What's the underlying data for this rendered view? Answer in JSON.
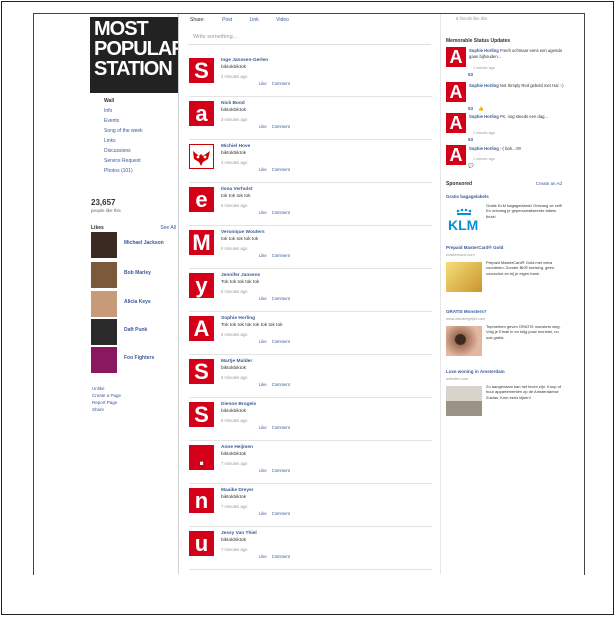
{
  "page": {
    "logo_lines": [
      "MOST",
      "POPULAR",
      "STATION"
    ]
  },
  "left_nav": {
    "items": [
      "Wall",
      "Info",
      "Events",
      "Song of the week",
      "Links",
      "Discussions",
      "Service Request",
      "Photos (101)"
    ],
    "fans_count": "23,657",
    "fans_label": "people like this",
    "likes_title": "Likes",
    "see_all": "See All",
    "likes": [
      {
        "name": "Michael Jackson",
        "color": "#3a2a22"
      },
      {
        "name": "Bob Marley",
        "color": "#7a5a3a"
      },
      {
        "name": "Alicia Keys",
        "color": "#c79b7a"
      },
      {
        "name": "Daft Punk",
        "color": "#2b2b2b"
      },
      {
        "name": "Foo Fighters",
        "color": "#8a1860"
      }
    ],
    "bottom_links": [
      "Unlike",
      "Create a Page",
      "Report Page",
      "Share"
    ]
  },
  "composer": {
    "tabs": [
      "Share:",
      "Post",
      "Link",
      "Video"
    ],
    "placeholder": "Write something..."
  },
  "feed": {
    "like_label": "Like",
    "comment_label": "Comment",
    "posts": [
      {
        "letter": "S",
        "name": "Inge Janssen-Gerlen",
        "message": "biktokbiktok",
        "time": "2 minutes ago"
      },
      {
        "letter": "a",
        "name": "Nick Bood",
        "message": "biktokbiktok",
        "time": "3 minutes ago"
      },
      {
        "letter": "",
        "name": "Michiel Hove",
        "message": "biktokbiktok",
        "time": "3 minutes ago"
      },
      {
        "letter": "e",
        "name": "Ilona Verhulst",
        "message": "tok tok tok tok",
        "time": "5 minutes ago"
      },
      {
        "letter": "M",
        "name": "Veronique Wouters",
        "message": "tok tok tok tok tok",
        "time": "6 minutes ago"
      },
      {
        "letter": "y",
        "name": "Jennifer Jansens",
        "message": "Tok tok tok tok tok",
        "time": "6 minutes ago"
      },
      {
        "letter": "A",
        "name": "Sophie Horling",
        "message": "Tok tok tok tok tok tok tok tok",
        "time": "6 minutes ago"
      },
      {
        "letter": "S",
        "name": "Martje Mulder",
        "message": "biktokbiktok",
        "time": "6 minutes ago"
      },
      {
        "letter": "S",
        "name": "Dienne Brugels",
        "message": "biktokbiktok",
        "time": "6 minutes ago"
      },
      {
        "letter": ".",
        "name": "Anne Heijmen",
        "message": "biktokbiktok",
        "time": "7 minutes ago"
      },
      {
        "letter": "n",
        "name": "Maaike Dreyer",
        "message": "biktokbiktok",
        "time": "7 minutes ago"
      },
      {
        "letter": "u",
        "name": "Jessy Van Thiel",
        "message": "biktokbiktok",
        "time": "7 minutes ago"
      }
    ]
  },
  "right": {
    "friends_text": "8 friends like this",
    "statuses_title": "Memorable Status Updates",
    "statuses": [
      {
        "name": "Sophie Horling",
        "text": "Freeh uchmaar eens een agenda gaan bijhouden...",
        "time": "1 minute ago",
        "count": "53"
      },
      {
        "name": "Sophie Horling",
        "text": "Not Simply Red gebeld met Hal :-)",
        "time": "",
        "count": "53"
      },
      {
        "name": "Sophie Horling",
        "text": "FK, nog steeds een dag...",
        "time": "1 minute ago",
        "count": "53"
      },
      {
        "name": "Sophie Horling",
        "text": ":-( bah...!!!!!",
        "time": "1 minute ago",
        "count": ""
      }
    ],
    "sponsored_label": "Sponsored",
    "create_ad": "Create an Ad",
    "ads": [
      {
        "title": "Gratis bagagelabels",
        "sub": "",
        "text": "Gratis KLM bagagelabels! Ontvang ze zelf! En ontvang je gepersonaliseerde labels thuis!",
        "img_color": "#ffffff"
      },
      {
        "title": "Prepaid MasterCard® Gold",
        "sub": "mastercard.com",
        "text": "Prepaid MasterCard® Gold met extra voordelen. Zonder BKR toetsing, geen voorschot en bij je eigen bank.",
        "img_color": "#e9c04a"
      },
      {
        "title": "GRATIS Monsters?",
        "sub": "www.abcdefghijkl.com",
        "text": "Topmerken geven GRATIS monsters weg. Volg je Email in en krijg jouw monster, nu ook gratis.",
        "img_color": "#a3705a"
      },
      {
        "title": "Luxe woning in Amsterdam",
        "sub": "website.com",
        "text": "Zo aangenaam kan het leven zijn. Koop of huur appartementen op de Amsterdamse Zuidas. Kom eens kijken!",
        "img_color": "#b8b2a8"
      }
    ]
  }
}
